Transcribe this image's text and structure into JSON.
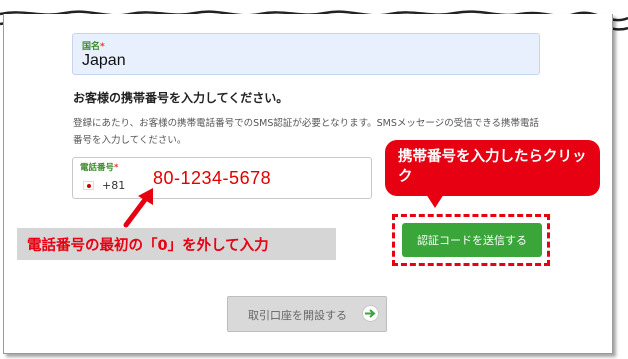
{
  "form": {
    "country_label": "国名",
    "required_mark": "*",
    "country_value": "Japan",
    "heading": "お客様の携帯番号を入力してください。",
    "description": "登録にあたり、お客様の携帯電話番号でのSMS認証が必要となります。SMSメッセージの受信できる携帯電話番号を入力してください。",
    "phone_label": "電話番号",
    "dial_code": "+81",
    "phone_value": "80-1234-5678",
    "send_button_label": "認証コードを送信する",
    "open_account_label": "取引口座を開設する"
  },
  "annotations": {
    "callout_text": "携帯番号を入力したらクリック",
    "note_text": "電話番号の最初の「0」を外して入力"
  },
  "colors": {
    "accent_red": "#e60012",
    "send_green": "#3aa63a",
    "label_green": "#3b8a2a"
  },
  "icons": {
    "flag": "japan-flag-icon",
    "arrow": "arrow-right-circle-icon"
  }
}
